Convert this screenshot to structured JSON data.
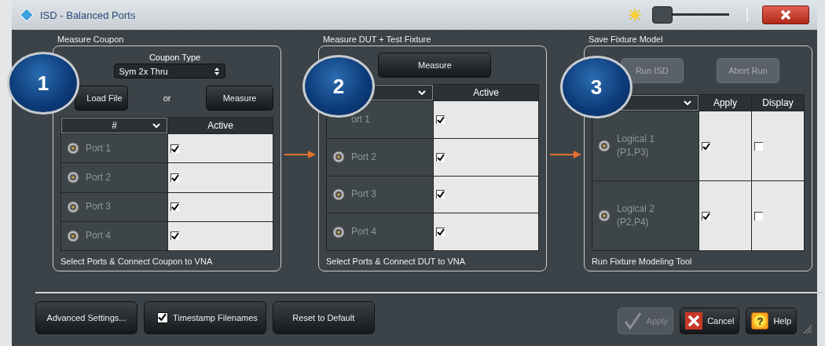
{
  "window": {
    "title": "ISD - Balanced Ports"
  },
  "brightness": {
    "level": 0.05
  },
  "panels": [
    {
      "kind": "coupon",
      "step": "1",
      "title": "Measure Coupon",
      "coupon_label": "Coupon Type",
      "coupon_value": "Sym 2x Thru",
      "buttons": [
        {
          "label": "Load File",
          "disabled": false
        },
        {
          "label": "Measure",
          "disabled": false
        }
      ],
      "separator": "or",
      "index_header": "#",
      "columns": [
        "Active"
      ],
      "rows": [
        {
          "label": "Port 1",
          "icon": true,
          "checks": [
            true
          ]
        },
        {
          "label": "Port 2",
          "icon": true,
          "checks": [
            true
          ]
        },
        {
          "label": "Port 3",
          "icon": true,
          "checks": [
            true
          ]
        },
        {
          "label": "Port 4",
          "icon": true,
          "checks": [
            true
          ]
        }
      ],
      "footer": "Select Ports & Connect Coupon to VNA"
    },
    {
      "kind": "dut",
      "step": "2",
      "title": "Measure DUT + Test Fixture",
      "buttons": [
        {
          "label": "Measure",
          "disabled": false
        }
      ],
      "columns": [
        "Active"
      ],
      "rows": [
        {
          "label": "ort 1",
          "icon": false,
          "checks": [
            true
          ]
        },
        {
          "label": "Port 2",
          "icon": true,
          "checks": [
            true
          ]
        },
        {
          "label": "Port 3",
          "icon": true,
          "checks": [
            true
          ]
        },
        {
          "label": "Port 4",
          "icon": true,
          "checks": [
            true
          ]
        }
      ],
      "footer": "Select Ports & Connect DUT to VNA"
    },
    {
      "kind": "fixture",
      "step": "3",
      "title": "Save Fixture Model",
      "buttons": [
        {
          "label": "Run ISD",
          "disabled": true
        },
        {
          "label": "Abort Run",
          "disabled": true
        }
      ],
      "columns": [
        "Apply",
        "Display"
      ],
      "rows": [
        {
          "label": "Logical 1",
          "detail": "(P1,P3)",
          "icon": true,
          "checks": [
            true,
            false
          ]
        },
        {
          "label": "Logical 2",
          "detail": "(P2,P4)",
          "icon": true,
          "checks": [
            true,
            false
          ]
        }
      ],
      "footer": "Run Fixture Modeling Tool"
    }
  ],
  "bottom_left": [
    {
      "kind": "button",
      "label": "Advanced Settings..."
    },
    {
      "kind": "checkbox",
      "label": "Timestamp Filenames",
      "checked": true
    },
    {
      "kind": "button",
      "label": "Reset to Default"
    }
  ],
  "bottom_right": [
    {
      "kind": "apply",
      "label": "Apply",
      "disabled": true
    },
    {
      "kind": "cancel",
      "label": "Cancel",
      "disabled": false
    },
    {
      "kind": "help",
      "label": "Help",
      "glyph": "?",
      "disabled": false
    }
  ]
}
